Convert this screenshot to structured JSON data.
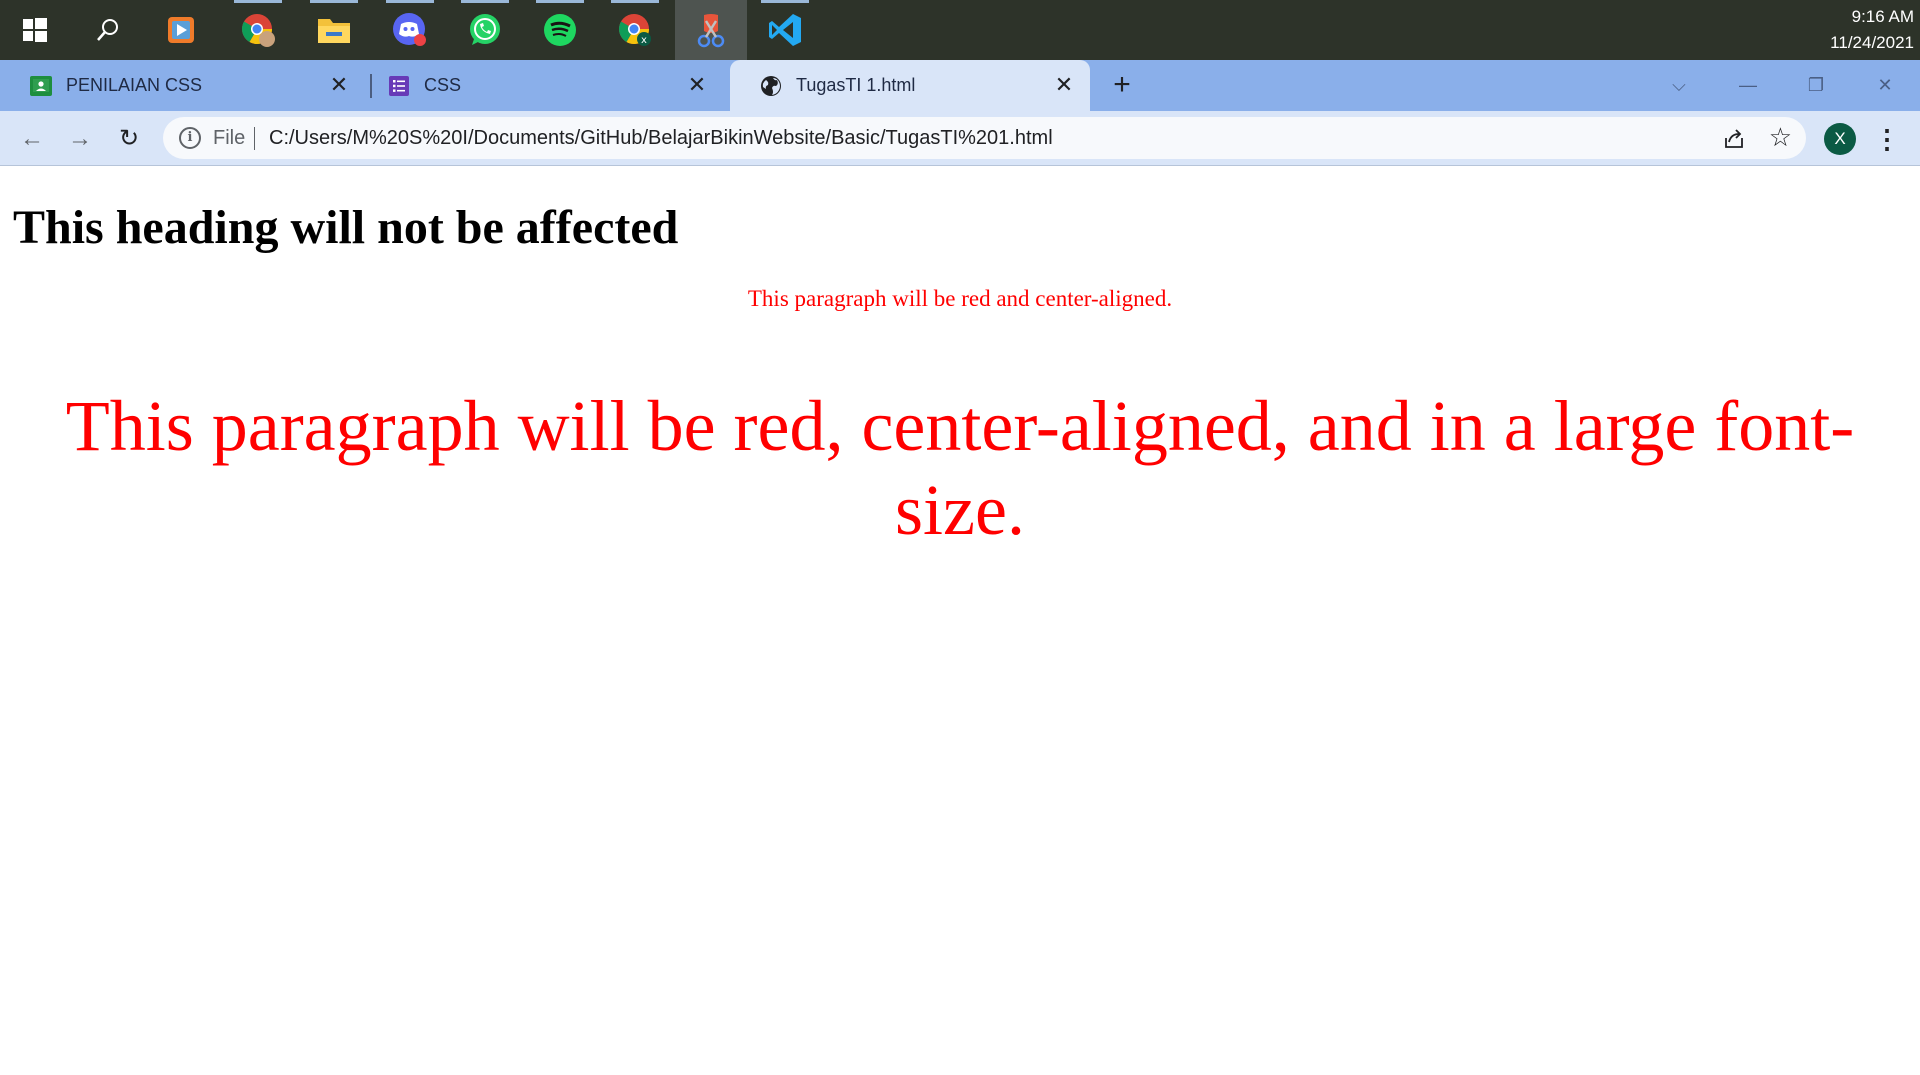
{
  "taskbar": {
    "icons": [
      "windows-start-icon",
      "search-icon",
      "media-player-icon",
      "chrome-profile-icon",
      "file-explorer-icon",
      "discord-icon",
      "whatsapp-icon",
      "spotify-icon",
      "chrome-icon",
      "snipping-tool-icon",
      "vscode-icon"
    ],
    "clock_time": "9:16 AM",
    "clock_date": "11/24/2021"
  },
  "tabs": [
    {
      "label": "PENILAIAN CSS",
      "icon": "google-classroom-icon",
      "active": false
    },
    {
      "label": "CSS",
      "icon": "google-forms-icon",
      "active": false
    },
    {
      "label": "TugasTI 1.html",
      "icon": "globe-icon",
      "active": true
    }
  ],
  "toolbar": {
    "scheme_label": "File",
    "url": "C:/Users/M%20S%20I/Documents/GitHub/BelajarBikinWebsite/Basic/TugasTI%201.html",
    "profile_initial": "X"
  },
  "page": {
    "heading": "This heading will not be affected",
    "paragraph_small": "This paragraph will be red and center-aligned.",
    "paragraph_large": "This paragraph will be red, center-aligned, and in a large font-size."
  },
  "colors": {
    "taskbar": "#2d3329",
    "tabstrip": "#8aafea",
    "toolbar": "#d9e5f8",
    "paragraph_text": "#ff0000",
    "avatar": "#0b5a44"
  }
}
